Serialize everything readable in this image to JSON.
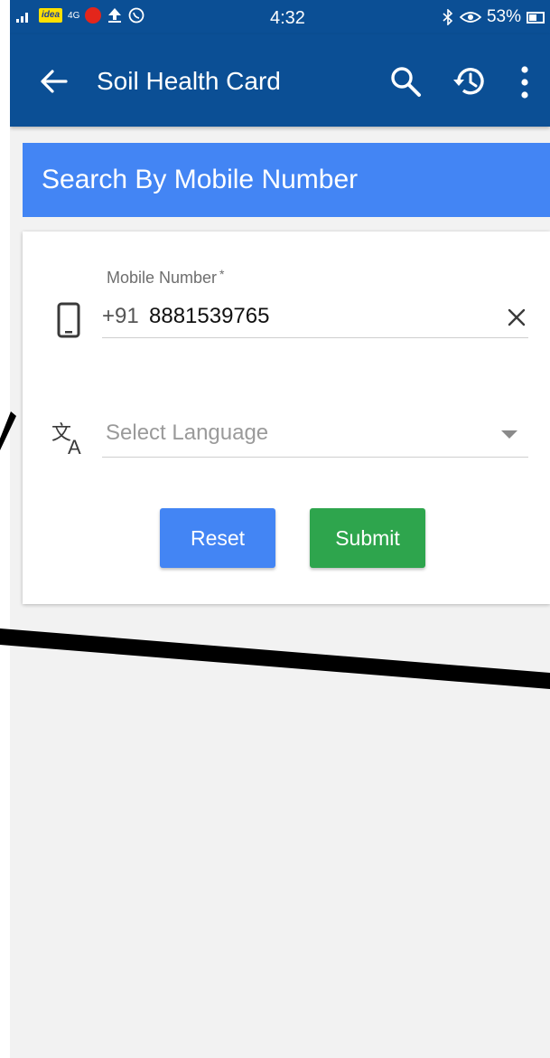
{
  "status_bar": {
    "carrier_badge": "idea",
    "network_type": "4G",
    "time": "4:32",
    "battery": "53%"
  },
  "app_bar": {
    "title": "Soil Health Card",
    "icons": [
      "back-arrow-icon",
      "search-icon",
      "history-icon",
      "more-vert-icon"
    ]
  },
  "section": {
    "title": "Search By Mobile Number"
  },
  "form": {
    "mobile": {
      "label": "Mobile Number",
      "required_mark": "*",
      "country_code": "+91",
      "value": "8881539765"
    },
    "language": {
      "placeholder": "Select Language"
    },
    "buttons": {
      "reset": "Reset",
      "submit": "Submit"
    }
  },
  "colors": {
    "app_bar": "#0b4f95",
    "section_header": "#4385f4",
    "reset_button": "#4385f4",
    "submit_button": "#2ea54d",
    "background": "#f2f2f2"
  }
}
